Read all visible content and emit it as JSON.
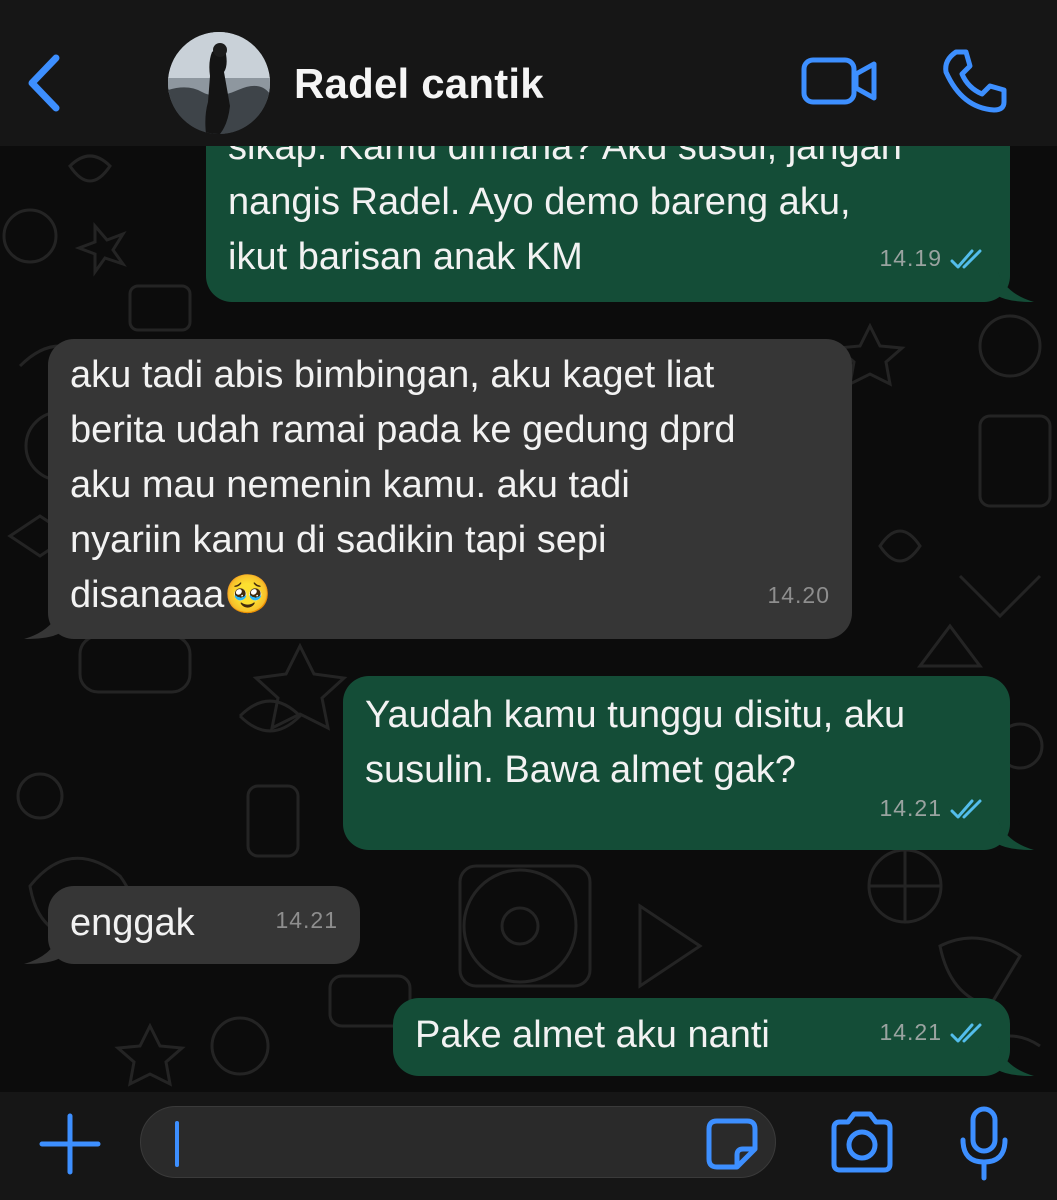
{
  "header": {
    "contact_name": "Radel cantik",
    "back_icon": "chevron-left-icon",
    "video_icon": "video-camera-icon",
    "call_icon": "phone-icon"
  },
  "messages": [
    {
      "direction": "out",
      "text": "sikap. Kamu dimana? Aku susul, jangan\nnangis Radel. Ayo demo bareng aku,\nikut barisan anak KM",
      "time": "14.19",
      "status": "read"
    },
    {
      "direction": "in",
      "text": "aku tadi abis bimbingan, aku kaget liat\nberita udah ramai pada ke gedung dprd\naku mau nemenin kamu. aku tadi\nnyariin kamu di sadikin tapi sepi\ndisanaaa",
      "emoji": "🥹",
      "time": "14.20"
    },
    {
      "direction": "out",
      "text": "Yaudah kamu tunggu disitu, aku\nsusulin. Bawa almet gak?",
      "time": "14.21",
      "status": "read"
    },
    {
      "direction": "in",
      "text": "enggak",
      "time": "14.21"
    },
    {
      "direction": "out",
      "text": "Pake almet aku nanti",
      "time": "14.21",
      "status": "read"
    }
  ],
  "composer": {
    "placeholder": "",
    "value": "",
    "icons": [
      "plus-icon",
      "sticker-icon",
      "camera-icon",
      "microphone-icon"
    ]
  },
  "colors": {
    "accent": "#3d8fff",
    "outgoing_bubble": "#144d37",
    "incoming_bubble": "#363636",
    "header_bg": "#161616",
    "read_check": "#53bdeb"
  }
}
